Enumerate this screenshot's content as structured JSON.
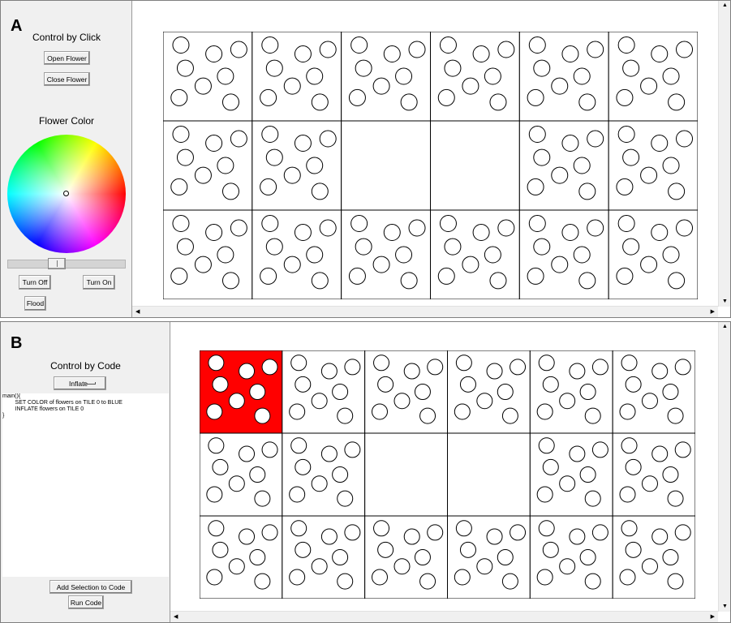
{
  "panel_a": {
    "letter": "A",
    "title": "Control by Click",
    "open_label": "Open Flower",
    "close_label": "Close Flower",
    "color_title": "Flower Color",
    "turn_off_label": "Turn Off",
    "turn_on_label": "Turn On",
    "flood_label": "Flood",
    "empty_tiles": [
      8,
      9
    ],
    "highlight_tiles": []
  },
  "panel_b": {
    "letter": "B",
    "title": "Control by Code",
    "dropdown_value": "Inflate",
    "code_lines": [
      "main(){",
      "        SET COLOR of flowers on TILE 0 to BLUE",
      "        INFLATE flowers on TILE 0",
      "}"
    ],
    "add_selection_label": "Add Selection to Code",
    "run_code_label": "Run Code",
    "empty_tiles": [
      8,
      9
    ],
    "highlight_tiles": [
      0
    ],
    "highlight_color": "#ff0000"
  },
  "colors": {
    "tile_border": "#000000",
    "flower_stroke": "#000000",
    "flower_fill": "#ffffff",
    "panel_bg": "#f0f0f0"
  }
}
